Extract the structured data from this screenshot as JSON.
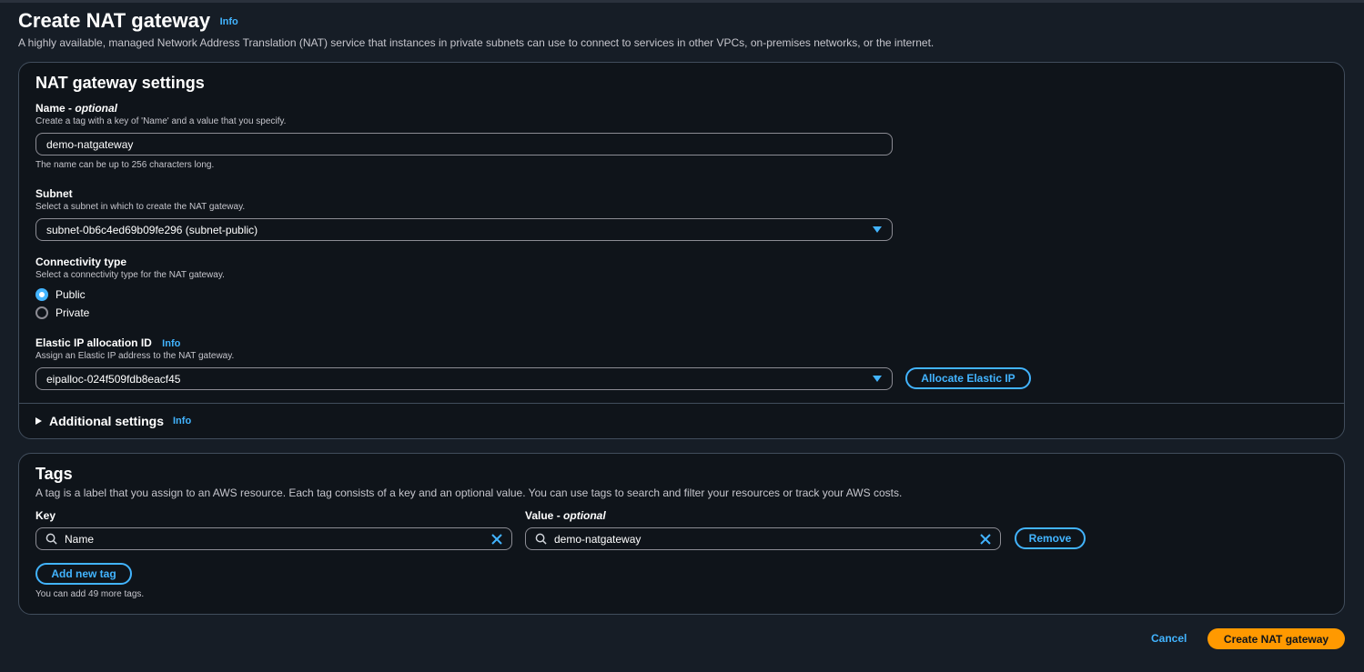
{
  "header": {
    "title": "Create NAT gateway",
    "info": "Info",
    "description": "A highly available, managed Network Address Translation (NAT) service that instances in private subnets can use to connect to services in other VPCs, on-premises networks, or the internet."
  },
  "settings": {
    "title": "NAT gateway settings",
    "name": {
      "label": "Name",
      "label_suffix": "optional",
      "description": "Create a tag with a key of 'Name' and a value that you specify.",
      "value": "demo-natgateway",
      "constraint": "The name can be up to 256 characters long."
    },
    "subnet": {
      "label": "Subnet",
      "description": "Select a subnet in which to create the NAT gateway.",
      "value": "subnet-0b6c4ed69b09fe296 (subnet-public)"
    },
    "connectivity": {
      "label": "Connectivity type",
      "description": "Select a connectivity type for the NAT gateway.",
      "options": [
        "Public",
        "Private"
      ],
      "selected": "Public"
    },
    "elastic_ip": {
      "label": "Elastic IP allocation ID",
      "info": "Info",
      "description": "Assign an Elastic IP address to the NAT gateway.",
      "value": "eipalloc-024f509fdb8eacf45",
      "allocate_button": "Allocate Elastic IP"
    },
    "additional": {
      "label": "Additional settings",
      "info": "Info"
    }
  },
  "tags": {
    "title": "Tags",
    "description": "A tag is a label that you assign to an AWS resource. Each tag consists of a key and an optional value. You can use tags to search and filter your resources or track your AWS costs.",
    "key_label": "Key",
    "value_label": "Value",
    "value_label_suffix": "optional",
    "rows": [
      {
        "key": "Name",
        "value": "demo-natgateway"
      }
    ],
    "remove_button": "Remove",
    "add_button": "Add new tag",
    "limit_text": "You can add 49 more tags."
  },
  "footer": {
    "cancel": "Cancel",
    "create": "Create NAT gateway"
  },
  "colors": {
    "accent": "#42b4ff",
    "primary_button": "#ff9900",
    "background": "#161d26",
    "panel": "#0f141a"
  }
}
